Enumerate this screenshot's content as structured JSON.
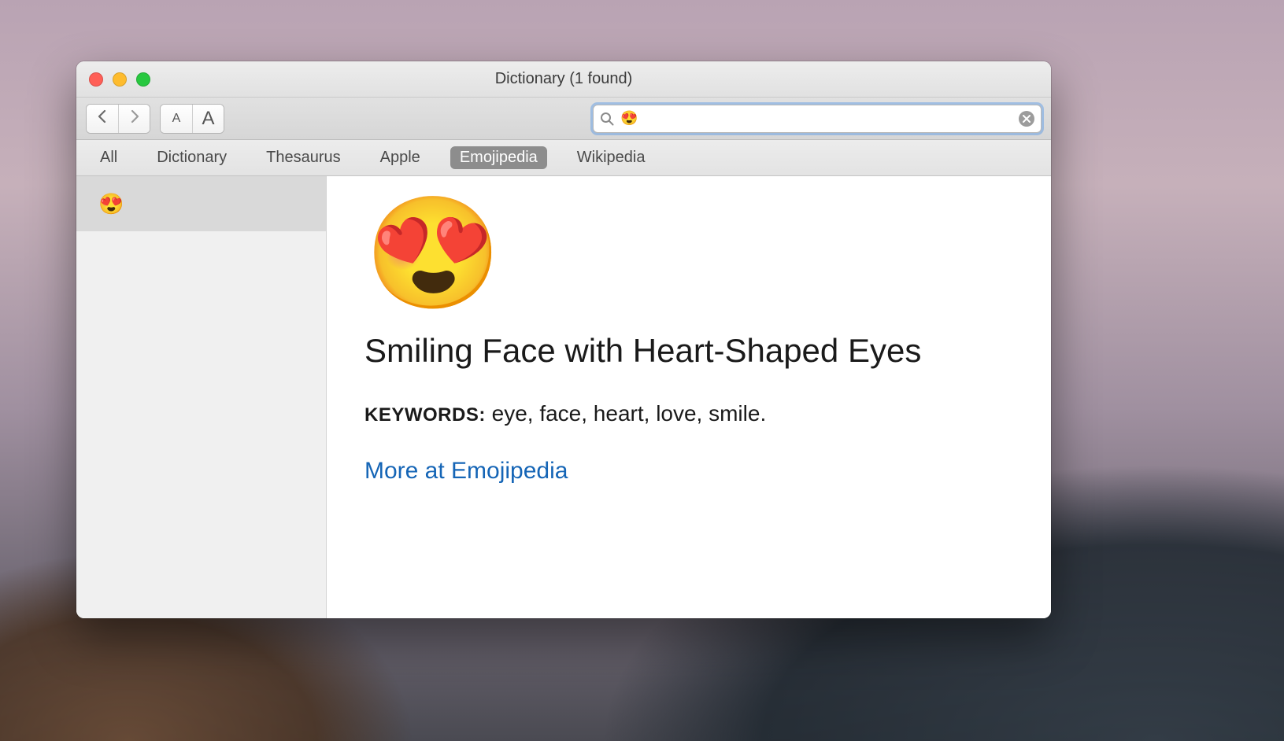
{
  "window": {
    "title": "Dictionary (1 found)"
  },
  "search": {
    "value": "😍"
  },
  "scopes": {
    "items": [
      "All",
      "Dictionary",
      "Thesaurus",
      "Apple",
      "Emojipedia",
      "Wikipedia"
    ],
    "active_index": 4
  },
  "sidebar": {
    "items": [
      {
        "label": "😍",
        "selected": true
      }
    ]
  },
  "entry": {
    "emoji": "😍",
    "title": "Smiling Face with Heart-Shaped Eyes",
    "keywords_label": "KEYWORDS:",
    "keywords_value": " eye, face, heart, love, smile.",
    "more_link": "More at Emojipedia"
  }
}
